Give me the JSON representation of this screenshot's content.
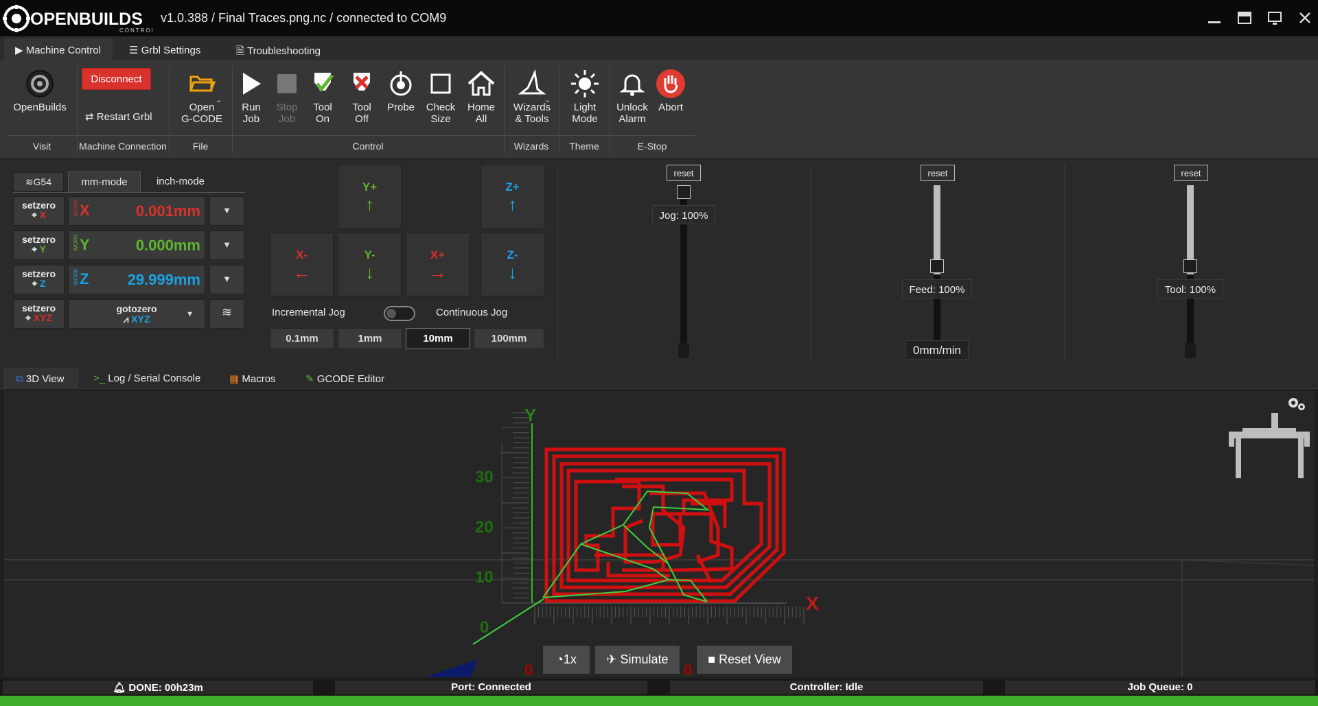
{
  "app": {
    "title": "v1.0.388 / Final Traces.png.nc / connected to COM9",
    "logo_text": "OPENBUILDS",
    "logo_sub": "CONTROL"
  },
  "window_controls": [
    "minimize",
    "maximize",
    "fullscreen",
    "close"
  ],
  "ribbon_tabs": [
    {
      "label": "Machine Control",
      "icon": "play-icon",
      "active": true
    },
    {
      "label": "Grbl Settings",
      "icon": "sliders-icon",
      "active": false
    },
    {
      "label": "Troubleshooting",
      "icon": "file-icon",
      "active": false
    }
  ],
  "ribbon": {
    "openbuilds": "OpenBuilds",
    "disconnect": "Disconnect",
    "restart": "Restart Grbl",
    "open_gcode_1": "Open",
    "open_gcode_2": "G-CODE",
    "run_1": "Run",
    "run_2": "Job",
    "stop_1": "Stop",
    "stop_2": "Job",
    "toolon_1": "Tool",
    "toolon_2": "On",
    "tooloff_1": "Tool",
    "tooloff_2": "Off",
    "probe": "Probe",
    "check_1": "Check",
    "check_2": "Size",
    "home_1": "Home",
    "home_2": "All",
    "wizards_1": "Wizards",
    "wizards_2": "& Tools",
    "light_1": "Light",
    "light_2": "Mode",
    "unlock_1": "Unlock",
    "unlock_2": "Alarm",
    "abort": "Abort",
    "groups": {
      "visit": "Visit",
      "machine_connection": "Machine Connection",
      "file": "File",
      "control": "Control",
      "wizards": "Wizards",
      "theme": "Theme",
      "estop": "E-Stop"
    },
    "colors": {
      "disconnect": "#d9312b",
      "abort": "#e03c31",
      "folder": "#f0a30a"
    }
  },
  "dro": {
    "wcs": "G54",
    "mm_mode": "mm-mode",
    "inch_mode": "inch-mode",
    "setzero": "setzero",
    "work": "WORK",
    "axes": [
      {
        "axis": "X",
        "value": "0.001mm",
        "color": "#d9312b"
      },
      {
        "axis": "Y",
        "value": "0.000mm",
        "color": "#5fb531"
      },
      {
        "axis": "Z",
        "value": "29.999mm",
        "color": "#1ba1e2"
      }
    ],
    "xyz": "XYZ",
    "gotozero": "gotozero"
  },
  "jog": {
    "yplus": "Y+",
    "yminus": "Y-",
    "xplus": "X+",
    "xminus": "X-",
    "zplus": "Z+",
    "zminus": "Z-",
    "incremental": "Incremental Jog",
    "continuous": "Continuous Jog",
    "steps": [
      "0.1mm",
      "1mm",
      "10mm",
      "100mm"
    ],
    "selected_step": "10mm"
  },
  "overrides": {
    "reset": "reset",
    "jog_label": "Jog: 100%",
    "feed_label": "Feed: 100%",
    "tool_label": "Tool: 100%",
    "feedrate": "0mm/min"
  },
  "view_tabs": [
    {
      "label": "3D View",
      "active": true
    },
    {
      "label": "Log / Serial Console",
      "active": false
    },
    {
      "label": "Macros",
      "active": false
    },
    {
      "label": "GCODE Editor",
      "active": false
    }
  ],
  "view": {
    "y_axis": "Y",
    "x_axis": "X",
    "y_ticks": [
      "30",
      "20",
      "10",
      "0"
    ],
    "speed": "1x",
    "simulate": "Simulate",
    "reset_view": "Reset View",
    "x_zero_labels": [
      "0",
      "0"
    ]
  },
  "status": {
    "done": "DONE: 00h23m",
    "port": "Port: Connected",
    "controller": "Controller: Idle",
    "queue": "Job Queue: 0"
  }
}
